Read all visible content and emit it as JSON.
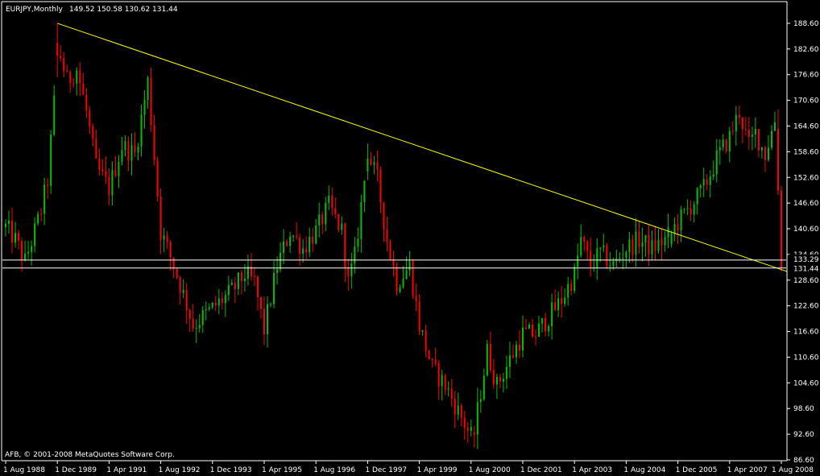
{
  "header": {
    "symbol": "EURJPY,Monthly",
    "ohlc": "149.52 150.58 130.62 131.44"
  },
  "footer": {
    "copyright": "AFB, © 2001-2008 MetaQuotes Software Corp."
  },
  "colors": {
    "background": "#000000",
    "axis": "#ffffff",
    "bull": "#00c000",
    "bear": "#ff0000",
    "trendline": "#ffff00",
    "hline": "#ffffff",
    "price_tag_bg": "#000000"
  },
  "chart_data": {
    "type": "candlestick",
    "title": "",
    "y_ticks": [
      "188.60",
      "182.60",
      "176.60",
      "170.60",
      "164.60",
      "158.60",
      "152.60",
      "146.60",
      "140.60",
      "134.60",
      "128.60",
      "122.60",
      "116.60",
      "110.60",
      "104.60",
      "98.60",
      "92.60",
      "86.60"
    ],
    "x_ticks": [
      "1 Aug 1988",
      "1 Dec 1989",
      "1 Apr 1991",
      "1 Aug 1992",
      "1 Dec 1993",
      "1 Apr 1995",
      "1 Aug 1996",
      "1 Dec 1997",
      "1 Apr 1999",
      "1 Aug 2000",
      "1 Dec 2001",
      "1 Apr 2003",
      "1 Aug 2004",
      "1 Dec 2005",
      "1 Apr 2007",
      "1 Aug 2008"
    ],
    "ylim": [
      86.6,
      191.6
    ],
    "xlim": [
      "1988-08",
      "2008-08"
    ],
    "trendline": {
      "from": {
        "date": "1989-12",
        "value": 188.6
      },
      "to": {
        "date": "2008-08",
        "value": 130.62
      }
    },
    "hlines": [
      {
        "label": "133.29",
        "value": 133.29
      },
      {
        "label": "131.44",
        "value": 131.44
      }
    ],
    "anchors": [
      [
        "1988-08",
        141
      ],
      [
        "1988-11",
        138
      ],
      [
        "1989-02",
        133
      ],
      [
        "1989-05",
        140
      ],
      [
        "1989-07",
        145
      ],
      [
        "1989-09",
        152
      ],
      [
        "1989-11",
        170
      ],
      [
        "1989-12",
        184
      ],
      [
        "1990-03",
        175
      ],
      [
        "1990-06",
        178
      ],
      [
        "1990-09",
        168
      ],
      [
        "1990-12",
        155
      ],
      [
        "1991-04",
        150
      ],
      [
        "1991-08",
        160
      ],
      [
        "1991-12",
        158
      ],
      [
        "1992-04",
        175
      ],
      [
        "1992-08",
        140
      ],
      [
        "1992-12",
        132
      ],
      [
        "1993-04",
        123
      ],
      [
        "1993-06",
        118
      ],
      [
        "1993-12",
        122
      ],
      [
        "1994-06",
        126
      ],
      [
        "1994-10",
        130
      ],
      [
        "1995-01",
        128
      ],
      [
        "1995-04",
        117
      ],
      [
        "1995-08",
        132
      ],
      [
        "1995-12",
        140
      ],
      [
        "1996-04",
        136
      ],
      [
        "1996-08",
        140
      ],
      [
        "1996-12",
        146
      ],
      [
        "1997-04",
        140
      ],
      [
        "1997-06",
        128
      ],
      [
        "1997-08",
        134
      ],
      [
        "1997-11",
        152
      ],
      [
        "1997-12",
        158
      ],
      [
        "1998-03",
        152
      ],
      [
        "1998-06",
        138
      ],
      [
        "1998-09",
        128
      ],
      [
        "1999-01",
        132
      ],
      [
        "1999-04",
        118
      ],
      [
        "1999-08",
        108
      ],
      [
        "1999-12",
        104
      ],
      [
        "2000-04",
        98
      ],
      [
        "2000-08",
        92
      ],
      [
        "2000-10",
        98
      ],
      [
        "2001-01",
        112
      ],
      [
        "2001-04",
        104
      ],
      [
        "2001-08",
        110
      ],
      [
        "2001-12",
        116
      ],
      [
        "2002-04",
        116
      ],
      [
        "2002-08",
        120
      ],
      [
        "2002-12",
        124
      ],
      [
        "2003-04",
        130
      ],
      [
        "2003-06",
        138
      ],
      [
        "2003-09",
        132
      ],
      [
        "2003-12",
        135
      ],
      [
        "2004-04",
        132
      ],
      [
        "2004-08",
        136
      ],
      [
        "2004-12",
        138
      ],
      [
        "2005-04",
        136
      ],
      [
        "2005-08",
        138
      ],
      [
        "2005-12",
        142
      ],
      [
        "2006-04",
        146
      ],
      [
        "2006-08",
        150
      ],
      [
        "2006-12",
        157
      ],
      [
        "2007-04",
        162
      ],
      [
        "2007-07",
        168
      ],
      [
        "2007-10",
        160
      ],
      [
        "2007-12",
        163
      ],
      [
        "2008-03",
        158
      ],
      [
        "2008-06",
        166
      ],
      [
        "2008-07",
        162
      ],
      [
        "2008-08",
        131.44
      ]
    ],
    "overrides": {
      "1989-12": [
        184,
        188.6,
        176,
        181
      ],
      "1997-12": [
        154,
        160.5,
        152,
        157
      ],
      "2000-09": [
        93,
        94.5,
        89.5,
        92.5
      ],
      "2005-10": [
        137,
        140.2,
        136.2,
        139.4
      ],
      "2008-07": [
        164,
        168.5,
        148.5,
        149.52
      ],
      "2008-08": [
        149.52,
        150.58,
        130.62,
        131.44
      ]
    }
  }
}
